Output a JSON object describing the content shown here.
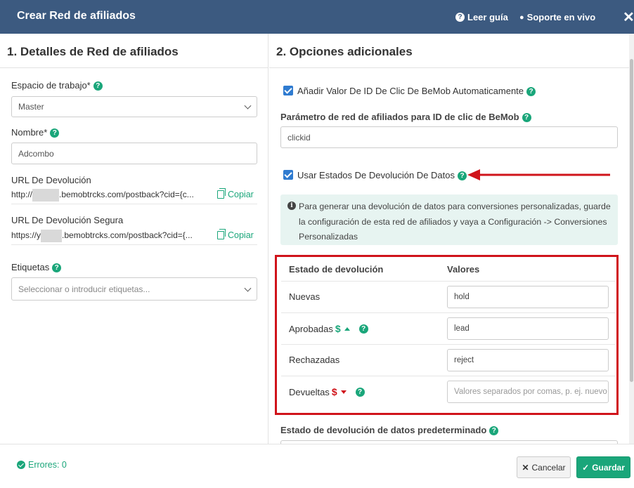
{
  "header": {
    "title": "Crear Red de afiliados",
    "guide_label": "Leer guía",
    "support_label": "Soporte en vivo",
    "close_symbol": "✕"
  },
  "left": {
    "heading": "1. Detalles de Red de afiliados",
    "workspace": {
      "label": "Espacio de trabajo*",
      "value": "Master"
    },
    "name": {
      "label": "Nombre*",
      "value": "Adcombo"
    },
    "postback_url": {
      "label": "URL De Devolución",
      "prefix": "http://",
      "suffix": ".bemobtrcks.com/postback?cid={c...",
      "copy_label": "Copiar"
    },
    "secure_postback_url": {
      "label": "URL De Devolución Segura",
      "prefix": "https://",
      "prefix_visible": "y",
      "suffix": ".bemobtrcks.com/postback?cid={...",
      "copy_label": "Copiar"
    },
    "tags": {
      "label": "Etiquetas",
      "placeholder": "Seleccionar o introducir etiquetas..."
    }
  },
  "right": {
    "heading": "2. Opciones adicionales",
    "auto_click_id": {
      "label": "Añadir Valor De ID De Clic De BeMob Automaticamente",
      "checked": true
    },
    "click_id_param": {
      "label": "Parámetro de red de afiliados para ID de clic de BeMob",
      "value": "clickid"
    },
    "use_postback_statuses": {
      "label": "Usar Estados De Devolución De Datos",
      "checked": true
    },
    "info_text": "Para generar una devolución de datos para conversiones personalizadas, guarde la configuración de esta red de afiliados y vaya a Configuración -> Conversiones Personalizadas",
    "status_table": {
      "col_status": "Estado de devolución",
      "col_values": "Valores",
      "rows": [
        {
          "name": "Nuevas",
          "value": "hold",
          "placeholder": ""
        },
        {
          "name": "Aprobadas",
          "value": "lead",
          "placeholder": "",
          "icon": "$"
        },
        {
          "name": "Rechazadas",
          "value": "reject",
          "placeholder": ""
        },
        {
          "name": "Devueltas",
          "value": "",
          "placeholder": "Valores separados por comas, p. ej. nuevo",
          "icon": "$"
        }
      ]
    },
    "default_status": {
      "label": "Estado de devolución de datos predeterminado"
    }
  },
  "footer": {
    "errors_label": "Errores: 0",
    "cancel_label": "Cancelar",
    "save_label": "Guardar"
  },
  "colors": {
    "header_bg": "#3c5a80",
    "accent_green": "#1aa67a",
    "checkbox_blue": "#2f7bd0",
    "highlight_red": "#d0141b",
    "info_bg": "#e7f4f1"
  }
}
